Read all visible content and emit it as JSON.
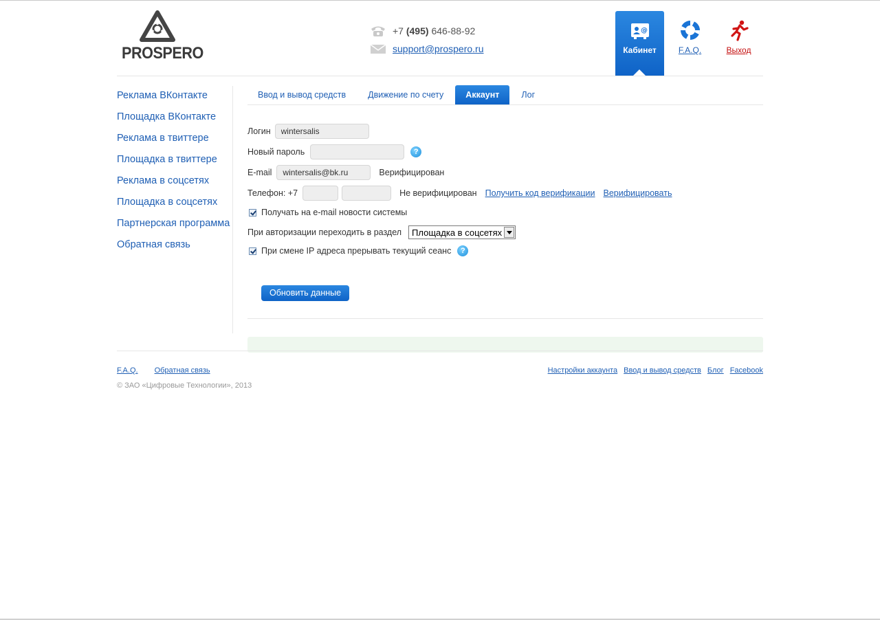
{
  "header": {
    "logo_text": "PROSPERO",
    "phone_prefix": "+7",
    "phone_code": "(495)",
    "phone_number": "646-88-92",
    "email": "support@prospero.ru",
    "nav": [
      {
        "label": "Кабинет",
        "icon": "cabinet-icon"
      },
      {
        "label": "F.A.Q.",
        "icon": "lifebuoy-icon"
      },
      {
        "label": "Выход",
        "icon": "running-man-icon"
      }
    ]
  },
  "sidebar": {
    "items": [
      {
        "label": "Реклама ВКонтакте"
      },
      {
        "label": "Площадка ВКонтакте"
      },
      {
        "label": "Реклама в твиттере"
      },
      {
        "label": "Площадка в твиттере"
      },
      {
        "label": "Реклама в соцсетях"
      },
      {
        "label": "Площадка в соцсетях"
      },
      {
        "label": "Партнерская программа"
      },
      {
        "label": "Обратная связь"
      }
    ]
  },
  "tabs": [
    {
      "label": "Ввод и вывод средств"
    },
    {
      "label": "Движение по счету"
    },
    {
      "label": "Аккаунт"
    },
    {
      "label": "Лог"
    }
  ],
  "form": {
    "login_label": "Логин",
    "login_value": "wintersalis",
    "password_label": "Новый пароль",
    "password_value": "",
    "help_glyph": "?",
    "email_label": "E-mail",
    "email_value": "wintersalis@bk.ru",
    "email_status": "Верифицирован",
    "phone_label": "Телефон: +7",
    "phone_code_value": "",
    "phone_number_value": "",
    "phone_status": "Не верифицирован",
    "get_code_link": "Получить код верификации",
    "verify_link": "Верифицировать",
    "news_checkbox_label": "Получать на e-mail новости системы",
    "redirect_label": "При авторизации переходить в раздел",
    "redirect_value": "Площадка в соцсетях",
    "ip_checkbox_label": "При смене IP адреса прерывать текущий сеанс",
    "submit_label": "Обновить данные"
  },
  "footer": {
    "left_links": [
      "F.A.Q.",
      "Обратная связь"
    ],
    "right_links": [
      "Настройки аккаунта",
      "Ввод и вывод средств",
      "Блог",
      "Facebook"
    ],
    "copyright": "© ЗАО «Цифровые Технологии», 2013"
  },
  "colors": {
    "accent": "#1a74d6",
    "link": "#1f5fb4",
    "exit": "#c40f0f",
    "status_bar": "#eef7ee"
  }
}
